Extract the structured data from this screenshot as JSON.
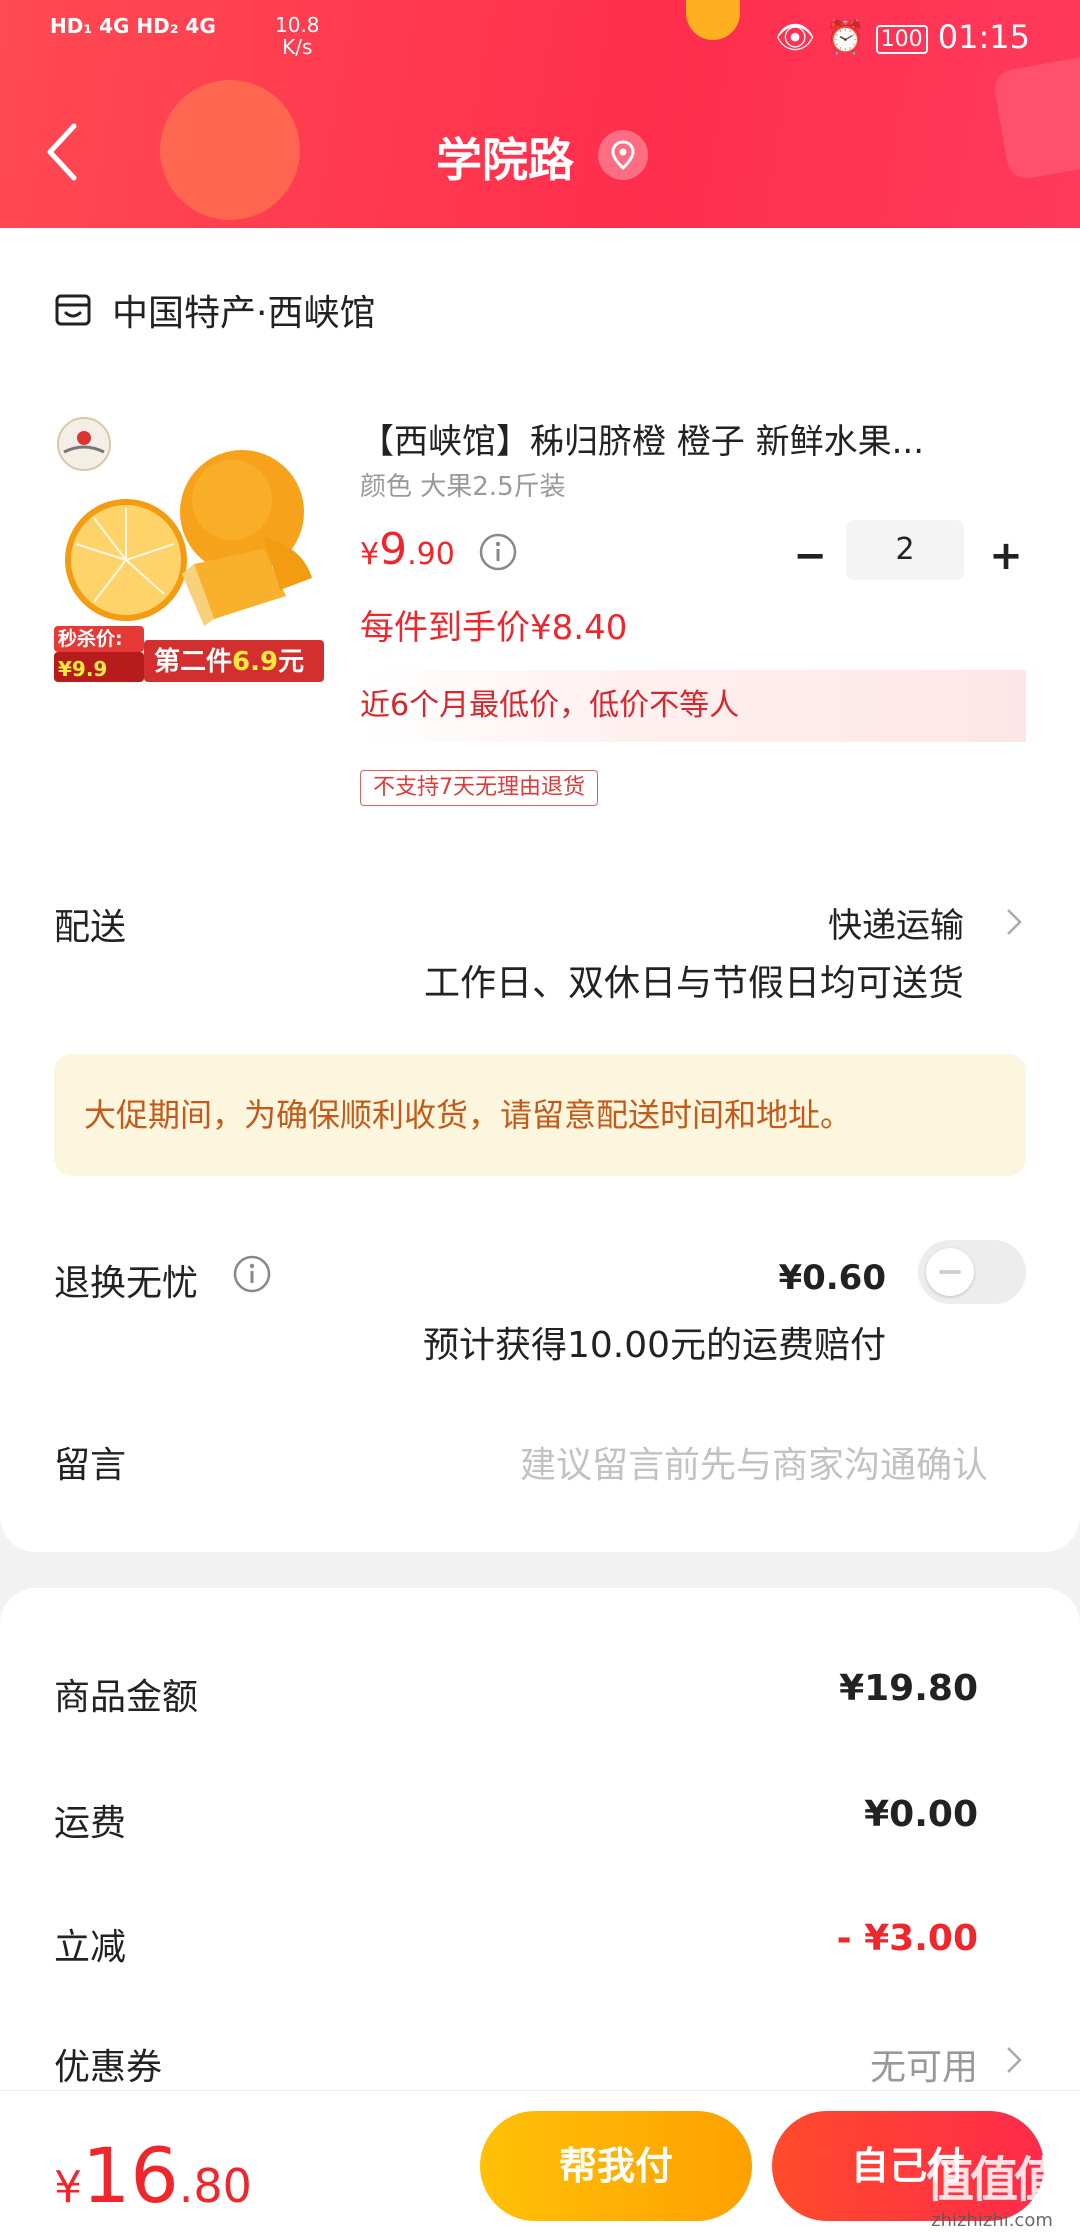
{
  "status_bar": {
    "left": "HD₁ 4G HD₂ 4G",
    "speed": "10.8",
    "speed_unit": "K/s",
    "battery": "100",
    "time": "01:15"
  },
  "header": {
    "title": "学院路"
  },
  "shop": {
    "name": "中国特产·西峡馆"
  },
  "product": {
    "title": "【西峡馆】秭归脐橙 橙子 新鲜水果...",
    "spec": "颜色 大果2.5斤装",
    "price_symbol": "¥",
    "price_int": "9",
    "price_dec": ".90",
    "quantity": "2",
    "final_price": "每件到手价¥8.40",
    "low_price_note": "近6个月最低价，低价不等人",
    "return_tag": "不支持7天无理由退货",
    "image_badge_left": "秒杀价:¥9.9",
    "image_badge_right": "第二件6.9元"
  },
  "delivery": {
    "label": "配送",
    "method": "快递运输",
    "note": "工作日、双休日与节假日均可送货"
  },
  "promo": {
    "text": "大促期间，为确保顺利收货，请留意配送时间和地址。"
  },
  "return_worry": {
    "label": "退换无忧",
    "price": "¥0.60",
    "note": "预计获得10.00元的运费赔付",
    "enabled": false
  },
  "message": {
    "label": "留言",
    "placeholder": "建议留言前先与商家沟通确认"
  },
  "summary": {
    "goods_label": "商品金额",
    "goods_value": "¥19.80",
    "shipping_label": "运费",
    "shipping_value": "¥0.00",
    "discount_label": "立减",
    "discount_value": "- ¥3.00",
    "coupon_label": "优惠券",
    "coupon_value": "无可用"
  },
  "bottom": {
    "total_symbol": "¥",
    "total_int": "16",
    "total_dec": ".80",
    "help_pay": "帮我付",
    "self_pay": "自己付"
  },
  "watermark": {
    "main": "值值值",
    "sub": "zhizhizhi.com"
  },
  "colors": {
    "accent_red": "#f0262d",
    "header_red": "#ff3a4f",
    "help_button": "#ffb300",
    "promo_bg": "#fdf6de"
  }
}
